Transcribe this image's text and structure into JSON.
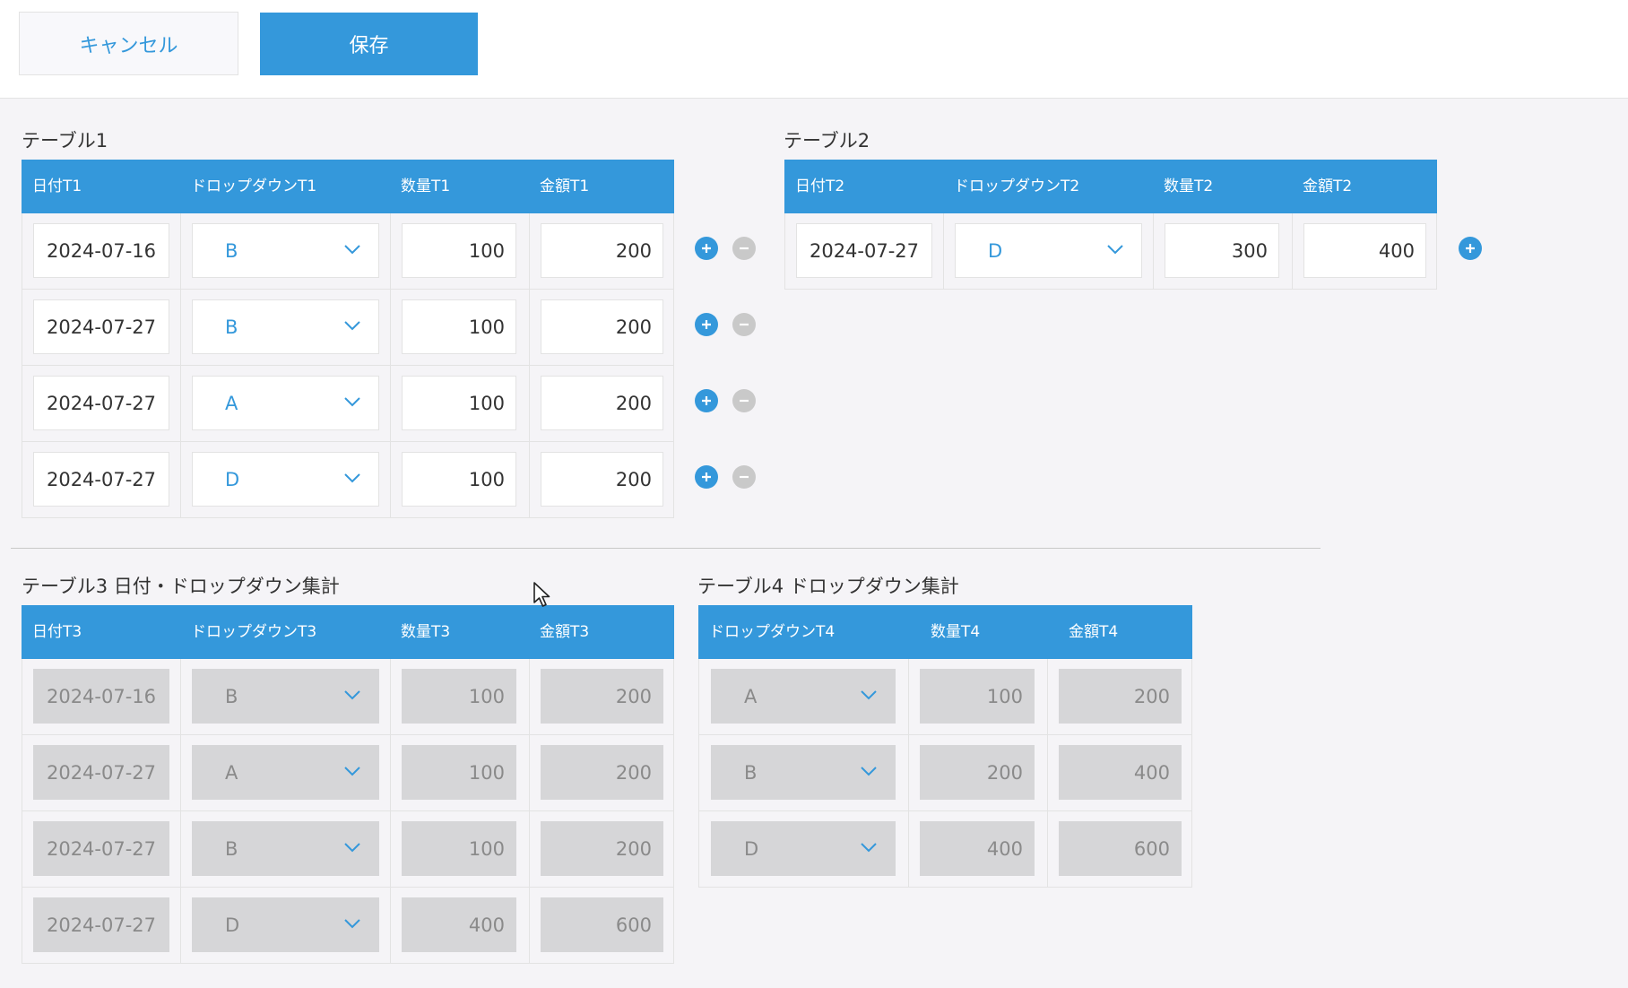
{
  "toolbar": {
    "cancel_label": "キャンセル",
    "save_label": "保存"
  },
  "table1": {
    "title": "テーブル1",
    "headers": [
      "日付T1",
      "ドロップダウンT1",
      "数量T1",
      "金額T1"
    ],
    "rows": [
      {
        "date": "2024-07-16",
        "dropdown": "B",
        "qty": "100",
        "amount": "200"
      },
      {
        "date": "2024-07-27",
        "dropdown": "B",
        "qty": "100",
        "amount": "200"
      },
      {
        "date": "2024-07-27",
        "dropdown": "A",
        "qty": "100",
        "amount": "200"
      },
      {
        "date": "2024-07-27",
        "dropdown": "D",
        "qty": "100",
        "amount": "200"
      }
    ]
  },
  "table2": {
    "title": "テーブル2",
    "headers": [
      "日付T2",
      "ドロップダウンT2",
      "数量T2",
      "金額T2"
    ],
    "rows": [
      {
        "date": "2024-07-27",
        "dropdown": "D",
        "qty": "300",
        "amount": "400"
      }
    ]
  },
  "table3": {
    "title": "テーブル3 日付・ドロップダウン集計",
    "headers": [
      "日付T3",
      "ドロップダウンT3",
      "数量T3",
      "金額T3"
    ],
    "rows": [
      {
        "date": "2024-07-16",
        "dropdown": "B",
        "qty": "100",
        "amount": "200"
      },
      {
        "date": "2024-07-27",
        "dropdown": "A",
        "qty": "100",
        "amount": "200"
      },
      {
        "date": "2024-07-27",
        "dropdown": "B",
        "qty": "100",
        "amount": "200"
      },
      {
        "date": "2024-07-27",
        "dropdown": "D",
        "qty": "400",
        "amount": "600"
      }
    ]
  },
  "table4": {
    "title": "テーブル4 ドロップダウン集計",
    "headers": [
      "ドロップダウンT4",
      "数量T4",
      "金額T4"
    ],
    "rows": [
      {
        "dropdown": "A",
        "qty": "100",
        "amount": "200"
      },
      {
        "dropdown": "B",
        "qty": "200",
        "amount": "400"
      },
      {
        "dropdown": "D",
        "qty": "400",
        "amount": "600"
      }
    ]
  },
  "icons": {
    "add": "plus-circle-icon",
    "remove": "minus-circle-icon",
    "dropdown": "chevron-down-icon",
    "cursor": "mouse-pointer-icon"
  },
  "colors": {
    "accent": "#3498db",
    "readonly_fill": "#d6d6d8",
    "remove_button": "#c9c9c9"
  }
}
